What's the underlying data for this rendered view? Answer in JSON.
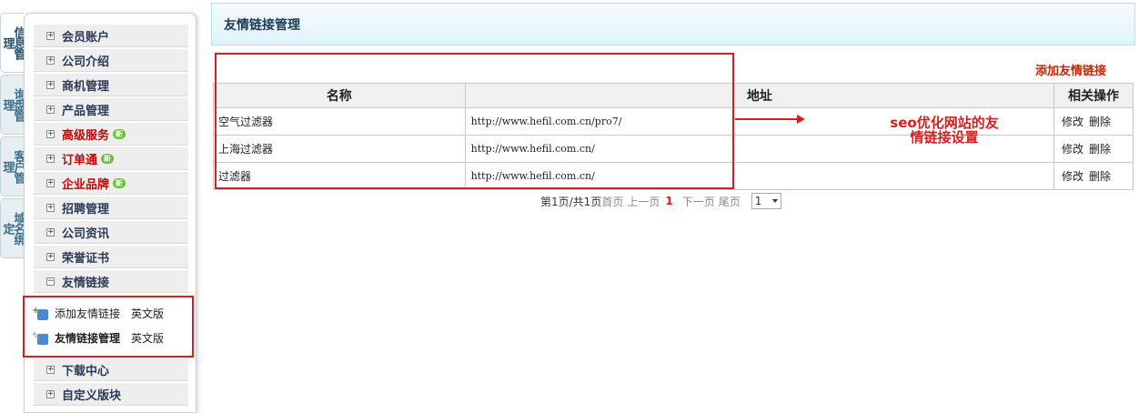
{
  "vtabs": [
    "信息管理",
    "询盘管理",
    "客户管理",
    "域名绑定"
  ],
  "menu": [
    {
      "label": "会员账户"
    },
    {
      "label": "公司介绍"
    },
    {
      "label": "商机管理"
    },
    {
      "label": "产品管理"
    },
    {
      "label": "高级服务",
      "badge": "新"
    },
    {
      "label": "订单通",
      "badge": "新"
    },
    {
      "label": "企业品牌",
      "badge": "新"
    },
    {
      "label": "招聘管理"
    },
    {
      "label": "公司资讯"
    },
    {
      "label": "荣誉证书"
    },
    {
      "label": "友情链接"
    }
  ],
  "submenu": [
    {
      "label": "添加友情链接",
      "en": "英文版"
    },
    {
      "label": "友情链接管理",
      "en": "英文版"
    }
  ],
  "menu_bottom": [
    {
      "label": "下载中心"
    },
    {
      "label": "自定义版块"
    }
  ],
  "main": {
    "title": "友情链接管理",
    "add_link": "添加友情链接",
    "columns": [
      "名称",
      "地址",
      "相关操作"
    ],
    "rows": [
      {
        "name": "空气过滤器",
        "url": "http://www.hefil.com.cn/pro7/",
        "edit": "修改",
        "del": "删除"
      },
      {
        "name": "上海过滤器",
        "url": "http://www.hefil.com.cn/",
        "edit": "修改",
        "del": "删除"
      },
      {
        "name": "过滤器",
        "url": "http://www.hefil.com.cn/",
        "edit": "修改",
        "del": "删除"
      }
    ],
    "annotation_line1": "seo优化网站的友",
    "annotation_line2": "情链接设置"
  },
  "pager": {
    "info": "第1页/共1页",
    "first": "首页",
    "prev": "上一页",
    "current": "1",
    "next": "下一页",
    "last": "尾页",
    "select_value": "1"
  },
  "colors": {
    "accent_red": "#d62020",
    "header_bg": "#dff3fb",
    "menu_text": "#2b3a55"
  }
}
